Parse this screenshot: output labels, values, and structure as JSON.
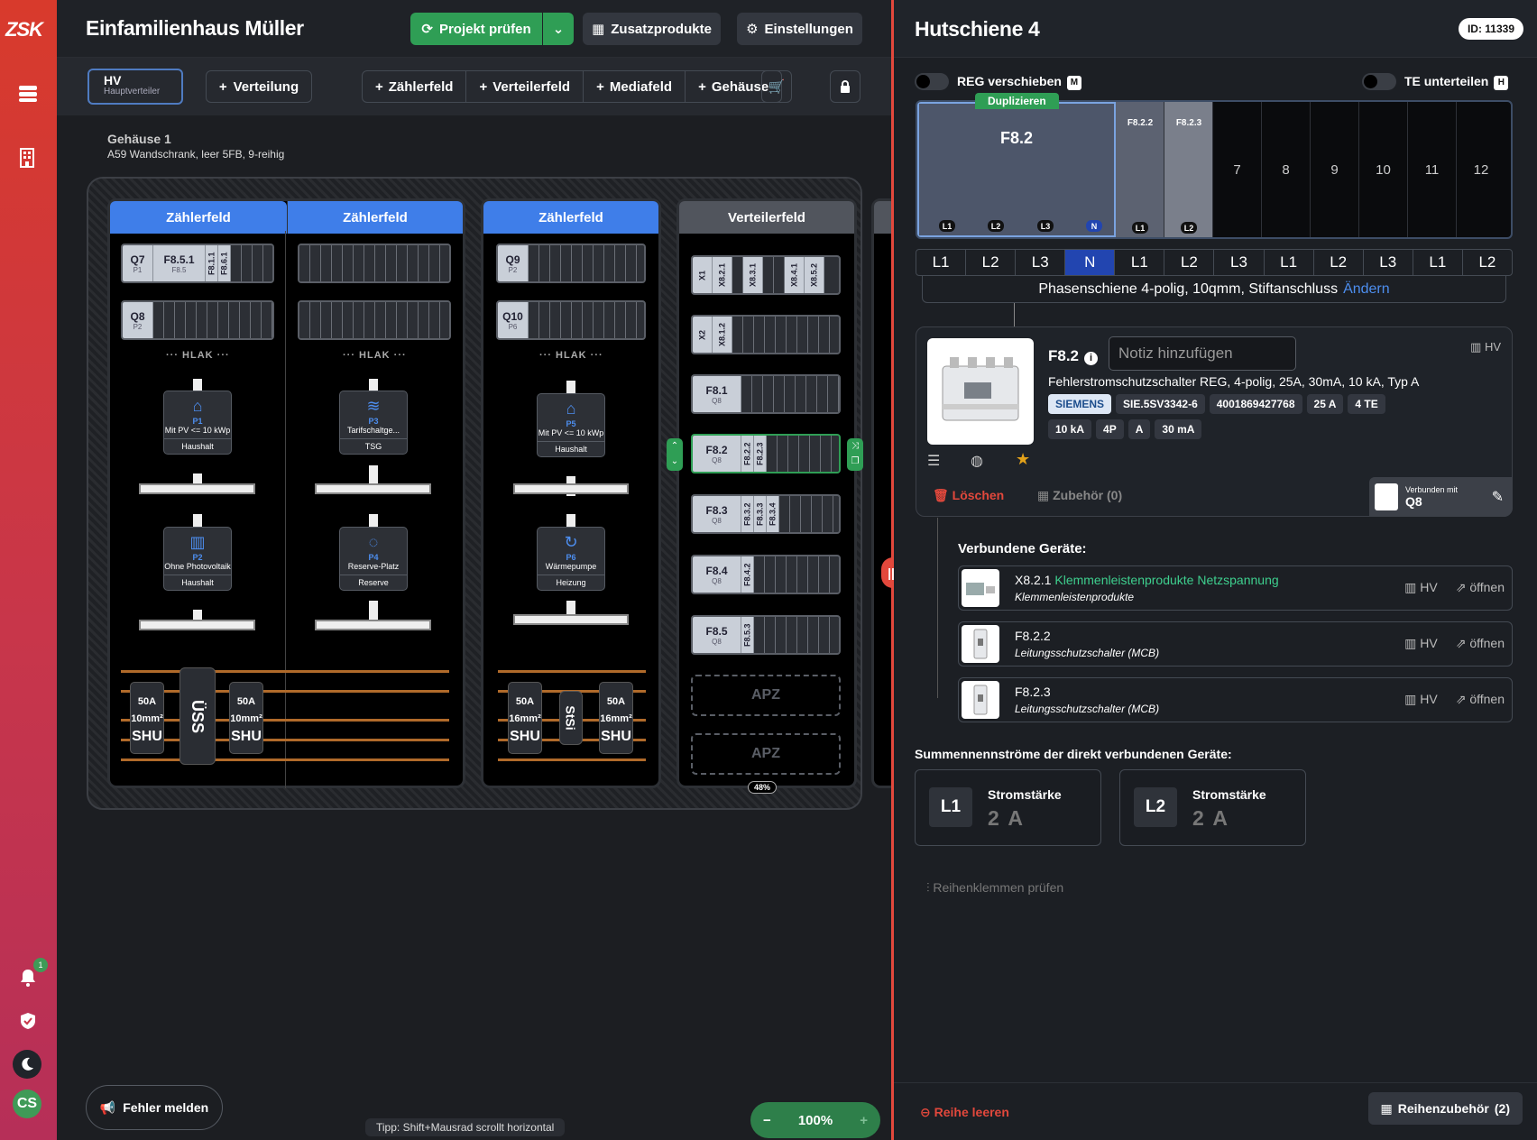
{
  "app": {
    "logo": "ZSK",
    "avatar": "CS",
    "notif_count": "1"
  },
  "header": {
    "title": "Einfamilienhaus Müller",
    "check": "Projekt prüfen",
    "extras": "Zusatzprodukte",
    "settings": "Einstellungen"
  },
  "toolbar": {
    "hv": "HV",
    "hv_sub": "Hauptverteiler",
    "verteilung": "Verteilung",
    "zaehlerfeld": "Zählerfeld",
    "verteilerfeld": "Verteilerfeld",
    "mediafeld": "Mediafeld",
    "gehaeuse": "Gehäuse"
  },
  "housing": {
    "title": "Gehäuse 1",
    "desc": "A59 Wandschrank, leer 5FB, 9-reihig"
  },
  "fields": [
    {
      "title": "Zählerfeld"
    },
    {
      "title": "Zählerfeld"
    },
    {
      "title": "Zählerfeld"
    },
    {
      "title": "Verteilerfeld"
    }
  ],
  "meters": {
    "q7": "Q7",
    "q7s": "P1",
    "f851": "F8.5.1",
    "f851s": "F8.5",
    "f811": "F8.1.1",
    "f861": "F8.6.1",
    "q8": "Q8",
    "q8s": "P2",
    "q9": "Q9",
    "q9s": "P2",
    "q10": "Q10",
    "q10s": "P6",
    "hlak": "··· HLAK ···",
    "p1": "P1",
    "p1d": "Mit PV <= 10 kWp",
    "p1f": "Haushalt",
    "p2": "P2",
    "p2d": "Ohne Photovoltaik",
    "p2f": "Haushalt",
    "p3": "P3",
    "p3d": "Tarifschaltge...",
    "p3f": "TSG",
    "p4": "P4",
    "p4d": "Reserve-Platz",
    "p4f": "Reserve",
    "p5": "P5",
    "p5d": "Mit PV <= 10 kWp",
    "p5f": "Haushalt",
    "p6": "P6",
    "p6d": "Wärmepumpe",
    "p6f": "Heizung",
    "a50": "50A",
    "mm10": "10mm²",
    "mm16": "16mm²",
    "shu": "SHU",
    "uss": "ÜSS",
    "stsi": "StSi"
  },
  "distrib": {
    "x1": "X1",
    "x821": "X8.2.1",
    "x831": "X8.3.1",
    "x841": "X8.4.1",
    "x852": "X8.5.2",
    "x2": "X2",
    "x812": "X8.1.2",
    "f81": "F8.1",
    "f82": "F8.2",
    "f83": "F8.3",
    "f84": "F8.4",
    "f85": "F8.5",
    "q8": "Q8",
    "f822": "F8.2.2",
    "f823": "F8.2.3",
    "f832": "F8.3.2",
    "f833": "F8.3.3",
    "f834": "F8.3.4",
    "f842": "F8.4.2",
    "f853": "F8.5.3",
    "apz": "APZ",
    "percent": "48%"
  },
  "bottom": {
    "fehler": "Fehler melden",
    "tipp": "Tipp: Shift+Mausrad scrollt horizontal",
    "zoom": "100%"
  },
  "panel": {
    "title": "Hutschiene 4",
    "id": "ID: 11339",
    "reg": "REG verschieben",
    "reg_key": "M",
    "te": "TE unterteilen",
    "te_key": "H",
    "dup": "Duplizieren",
    "sel": "F8.2",
    "sub1": "F8.2.2",
    "sub2": "F8.2.3",
    "slots": [
      "7",
      "8",
      "9",
      "10",
      "11",
      "12"
    ],
    "terms": [
      "L1",
      "L2",
      "L3",
      "N"
    ],
    "phases": [
      "L1",
      "L2",
      "L3",
      "N",
      "L1",
      "L2",
      "L3",
      "L1",
      "L2",
      "L3",
      "L1",
      "L2"
    ],
    "phaserail": "Phasenschiene 4-polig, 10qmm, Stiftanschluss",
    "aendern": "Ändern"
  },
  "device": {
    "name": "F8.2",
    "note_ph": "Notiz hinzufügen",
    "hv": "HV",
    "desc": "Fehlerstromschutzschalter REG, 4-polig, 25A, 30mA, 10 kA, Typ A",
    "brand": "SIEMENS",
    "chips": [
      "SIE.5SV3342-6",
      "4001869427768",
      "25 A",
      "4 TE"
    ],
    "chips2": [
      "10 kA",
      "4P",
      "A",
      "30 mA"
    ],
    "delete": "Löschen",
    "zubehoer": "Zubehör (0)",
    "conn_label": "Verbunden mit",
    "conn_val": "Q8"
  },
  "connected": {
    "title": "Verbundene Geräte:",
    "items": [
      {
        "id": "X8.2.1",
        "name": "Klemmenleistenprodukte Netzspannung",
        "cat": "Klemmenleistenprodukte",
        "hv": "HV",
        "open": "öffnen"
      },
      {
        "id": "F8.2.2",
        "name": "",
        "cat": "Leitungsschutzschalter (MCB)",
        "hv": "HV",
        "open": "öffnen"
      },
      {
        "id": "F8.2.3",
        "name": "",
        "cat": "Leitungsschutzschalter (MCB)",
        "hv": "HV",
        "open": "öffnen"
      }
    ]
  },
  "sums": {
    "title": "Summennennströme der direkt verbundenen Geräte:",
    "l1": "L1",
    "l2": "L2",
    "label": "Stromstärke",
    "v1": "2 A",
    "v2": "2 A"
  },
  "reihen": "Reihenklemmen prüfen",
  "footer": {
    "leeren": "Reihe leeren",
    "zub": "Reihenzubehör",
    "zubcount": "(2)"
  },
  "colors": {
    "accent": "#3f7ee9",
    "green": "#2f9e55",
    "red": "#e2483c",
    "teal": "#3ecf8e"
  }
}
